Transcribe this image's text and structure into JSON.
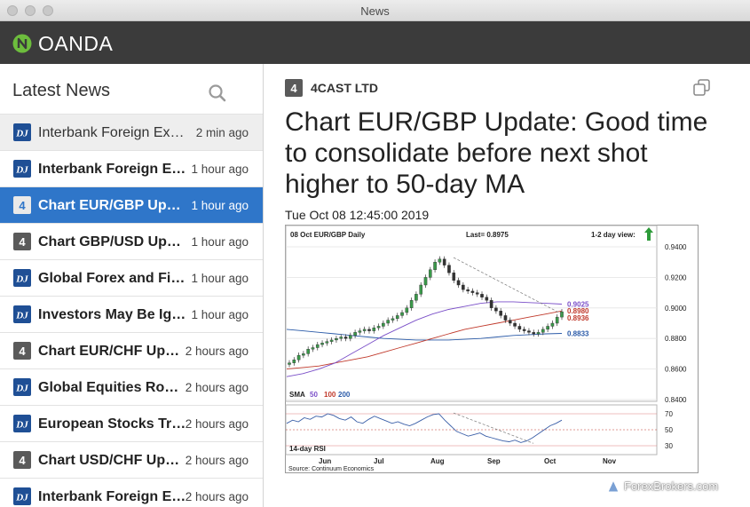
{
  "window": {
    "title": "News"
  },
  "app": {
    "brand": "OANDA",
    "brand_color": "#6dbd3d"
  },
  "sidebar": {
    "title": "Latest News",
    "search_icon": "search-icon",
    "items": [
      {
        "source": "dj",
        "title": "Interbank Foreign Exchange Rates",
        "time": "2 min ago",
        "state": "read"
      },
      {
        "source": "dj",
        "title": "Interbank Foreign Exchange Rates",
        "time": "1 hour ago",
        "state": "unread"
      },
      {
        "source": "4cast",
        "title": "Chart EUR/GBP Update",
        "time": "1 hour ago",
        "state": "selected"
      },
      {
        "source": "4cast",
        "title": "Chart GBP/USD Update",
        "time": "1 hour ago",
        "state": "unread"
      },
      {
        "source": "dj",
        "title": "Global Forex and Fixed Income",
        "time": "1 hour ago",
        "state": "unread"
      },
      {
        "source": "dj",
        "title": "Investors May Be Ignoring",
        "time": "1 hour ago",
        "state": "unread"
      },
      {
        "source": "4cast",
        "title": "Chart EUR/CHF Update",
        "time": "2 hours ago",
        "state": "unread"
      },
      {
        "source": "dj",
        "title": "Global Equities Roundup",
        "time": "2 hours ago",
        "state": "unread"
      },
      {
        "source": "dj",
        "title": "European Stocks Trade",
        "time": "2 hours ago",
        "state": "unread"
      },
      {
        "source": "4cast",
        "title": "Chart USD/CHF Update",
        "time": "2 hours ago",
        "state": "unread"
      },
      {
        "source": "dj",
        "title": "Interbank Foreign Exchange Rates",
        "time": "2 hours ago",
        "state": "unread"
      }
    ]
  },
  "article": {
    "provider": "4CAST LTD",
    "headline": "Chart EUR/GBP Update: Good time to consolidate before next shot higher to 50-day MA",
    "date": "Tue Oct 08 12:45:00 2019",
    "popout_icon": "popout-window-icon"
  },
  "chart_data": {
    "type": "line",
    "header_left": "08 Oct   EUR/GBP   Daily",
    "header_last": "Last= 0.8975",
    "header_view": "1-2 day view:",
    "view_arrow_color": "#2e9b3a",
    "price_ticks": [
      "0.9400",
      "0.9200",
      "0.9000",
      "0.8800",
      "0.8600",
      "0.8400"
    ],
    "price_range": [
      0.84,
      0.94
    ],
    "levels": [
      {
        "label": "0.9025",
        "value": 0.9025,
        "color": "#7a4fc8"
      },
      {
        "label": "0.8980",
        "value": 0.898,
        "color": "#c0392b"
      },
      {
        "label": "0.8936",
        "value": 0.8936,
        "color": "#c0392b"
      },
      {
        "label": "0.8833",
        "value": 0.8833,
        "color": "#2a5aa8"
      }
    ],
    "sma_label": "SMA",
    "sma_periods": [
      {
        "label": "50",
        "color": "#7a4fc8"
      },
      {
        "label": "100",
        "color": "#c0392b"
      },
      {
        "label": "200",
        "color": "#2a5aa8"
      }
    ],
    "rsi_label": "14-day RSI",
    "rsi_ticks": [
      "70",
      "50",
      "30"
    ],
    "rsi_range": [
      20,
      80
    ],
    "months": [
      "Jun",
      "Jul",
      "Aug",
      "Sep",
      "Oct",
      "Nov"
    ],
    "source_note": "Source: Continuum Economics",
    "close_series": [
      0.864,
      0.866,
      0.869,
      0.87,
      0.873,
      0.874,
      0.876,
      0.877,
      0.878,
      0.879,
      0.88,
      0.881,
      0.88,
      0.882,
      0.884,
      0.885,
      0.886,
      0.885,
      0.887,
      0.888,
      0.89,
      0.892,
      0.893,
      0.895,
      0.897,
      0.9,
      0.905,
      0.909,
      0.915,
      0.92,
      0.925,
      0.93,
      0.932,
      0.928,
      0.923,
      0.918,
      0.915,
      0.912,
      0.911,
      0.91,
      0.909,
      0.907,
      0.905,
      0.9,
      0.898,
      0.895,
      0.892,
      0.89,
      0.888,
      0.886,
      0.885,
      0.884,
      0.883,
      0.884,
      0.886,
      0.888,
      0.89,
      0.894,
      0.8975
    ],
    "sma50_series": [
      0.855,
      0.857,
      0.86,
      0.864,
      0.87,
      0.876,
      0.882,
      0.887,
      0.892,
      0.896,
      0.899,
      0.901,
      0.903,
      0.904,
      0.904,
      0.9035,
      0.903,
      0.9025
    ],
    "sma100_series": [
      0.86,
      0.861,
      0.862,
      0.864,
      0.866,
      0.868,
      0.871,
      0.874,
      0.877,
      0.88,
      0.883,
      0.886,
      0.888,
      0.89,
      0.892,
      0.894,
      0.896,
      0.898
    ],
    "sma200_series": [
      0.886,
      0.885,
      0.884,
      0.883,
      0.882,
      0.881,
      0.88,
      0.8795,
      0.879,
      0.879,
      0.879,
      0.8795,
      0.88,
      0.881,
      0.882,
      0.8825,
      0.883,
      0.8833
    ],
    "rsi_series": [
      58,
      62,
      60,
      65,
      63,
      67,
      66,
      70,
      68,
      64,
      62,
      66,
      60,
      58,
      63,
      67,
      64,
      61,
      58,
      60,
      57,
      55,
      58,
      62,
      66,
      69,
      70,
      62,
      55,
      48,
      45,
      42,
      44,
      46,
      42,
      40,
      38,
      36,
      35,
      37,
      34,
      36,
      40,
      45,
      50,
      55,
      58,
      62
    ]
  },
  "watermark": {
    "text": "ForexBrokers.com"
  }
}
